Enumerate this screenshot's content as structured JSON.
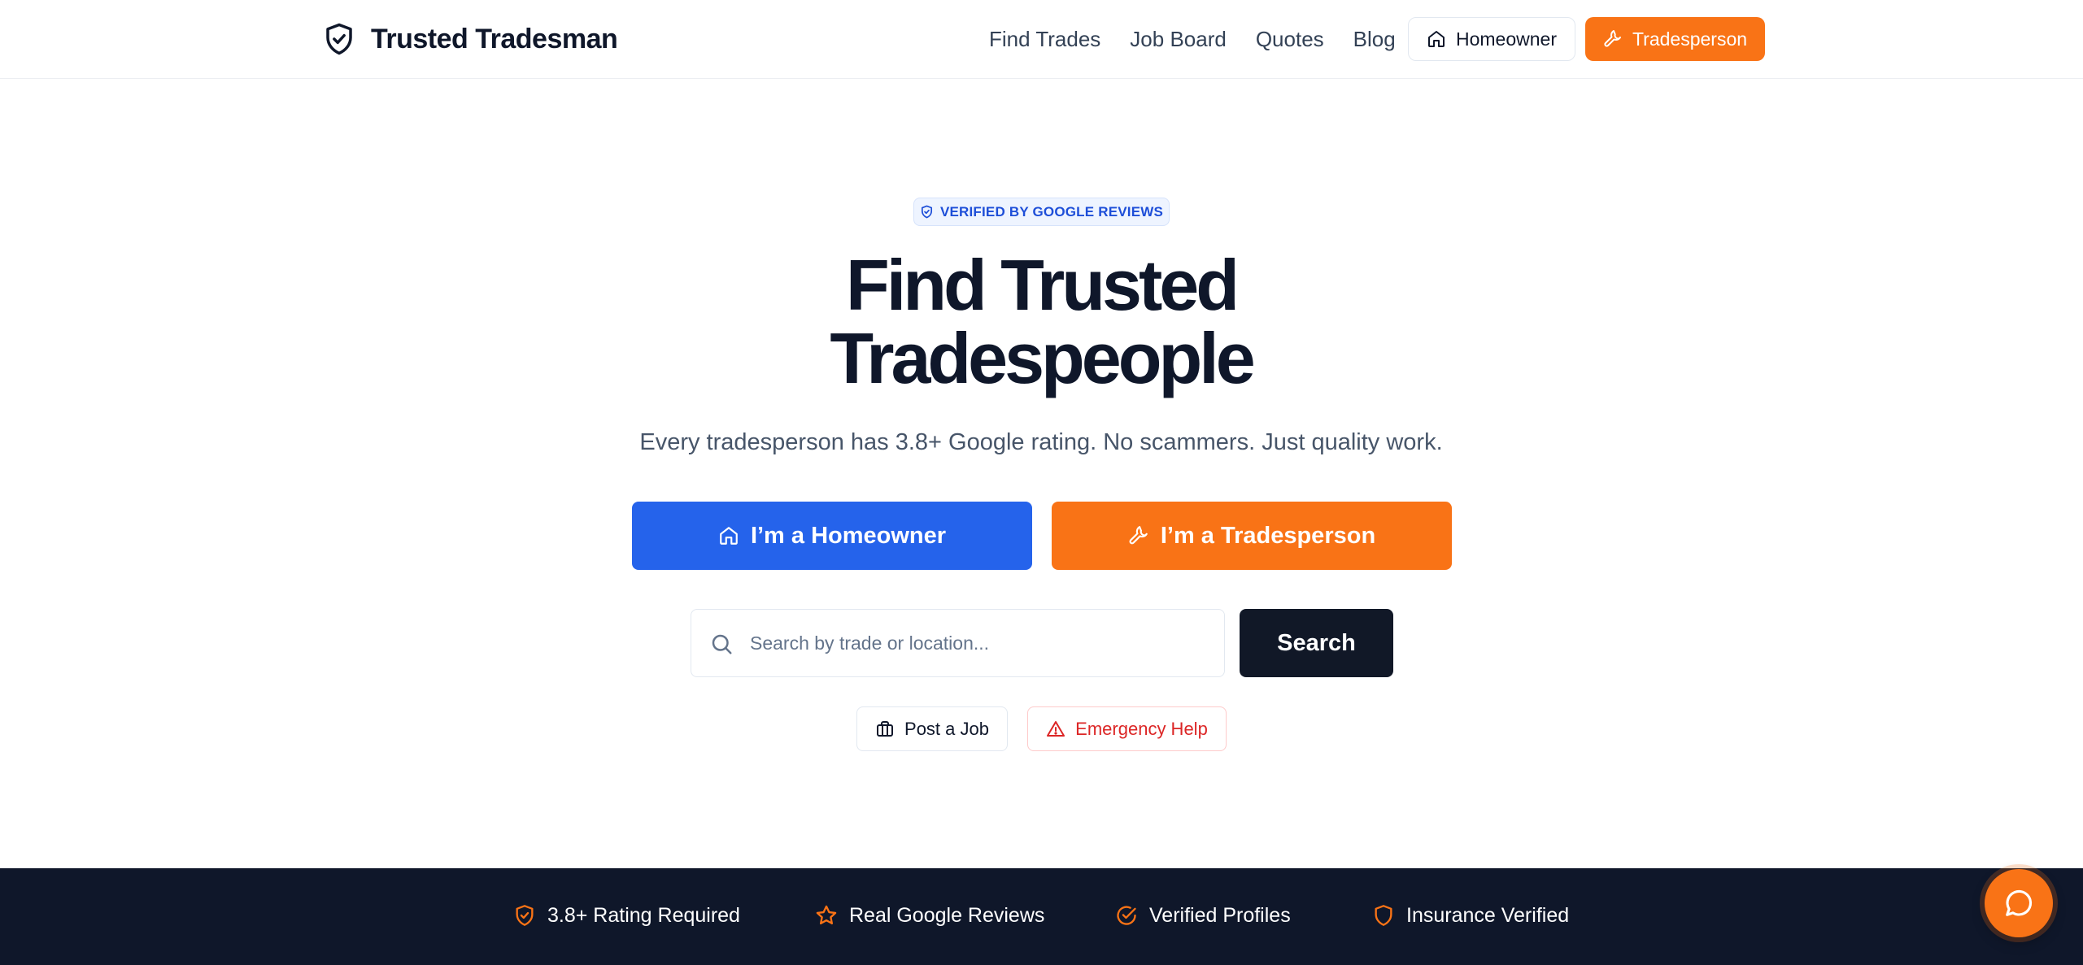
{
  "header": {
    "brand": "Trusted Tradesman",
    "nav": [
      "Find Trades",
      "Job Board",
      "Quotes",
      "Blog"
    ],
    "homeowner_label": "Homeowner",
    "tradesperson_label": "Tradesperson"
  },
  "hero": {
    "badge": "VERIFIED BY GOOGLE REVIEWS",
    "title_line1": "Find Trusted",
    "title_line2": "Tradespeople",
    "subtitle": "Every tradesperson has 3.8+ Google rating. No scammers. Just quality work.",
    "cta_homeowner": "I’m a Homeowner",
    "cta_tradesperson": "I’m a Tradesperson"
  },
  "search": {
    "placeholder": "Search by trade or location...",
    "button": "Search"
  },
  "actions": {
    "post_job": "Post a Job",
    "emergency": "Emergency Help"
  },
  "trust": [
    {
      "label": "3.8+ Rating Required",
      "icon": "shield-check-icon"
    },
    {
      "label": "Real Google Reviews",
      "icon": "star-icon"
    },
    {
      "label": "Verified Profiles",
      "icon": "check-circle-icon"
    },
    {
      "label": "Insurance Verified",
      "icon": "shield-icon"
    }
  ],
  "colors": {
    "primary_blue": "#2563eb",
    "accent_orange": "#f97316",
    "dark_navy": "#0f172a",
    "danger_red": "#dc2626"
  },
  "chat": {
    "icon": "chat-bubble-icon"
  }
}
